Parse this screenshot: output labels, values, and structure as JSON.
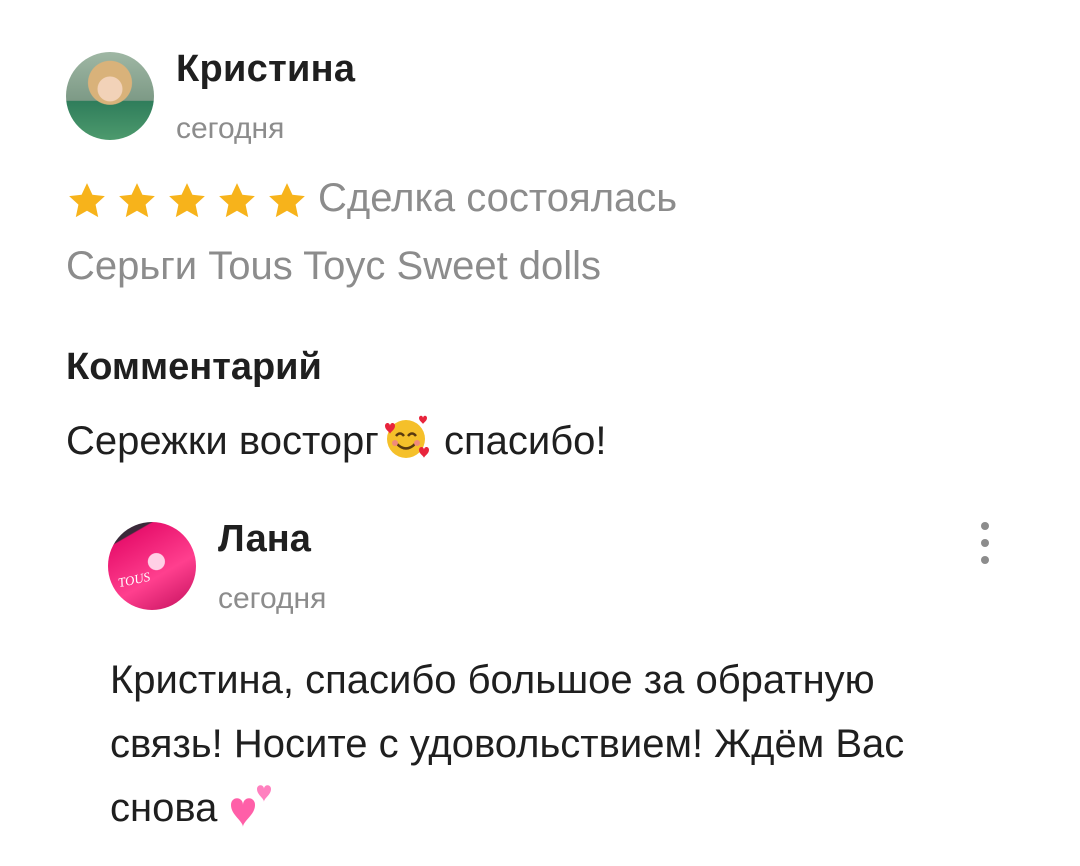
{
  "review": {
    "author": "Кристина",
    "date": "сегодня",
    "rating": 5,
    "rating_max": 5,
    "star_color": "#f7b31b",
    "deal_status": "Сделка состоялась",
    "product": "Серьги Tous Toyc Sweet dolls",
    "comment_heading": "Комментарий",
    "comment_before": "Сережки восторг",
    "comment_emoji": "smiling-face-with-hearts",
    "comment_after": " спасибо!"
  },
  "reply": {
    "author": "Лана",
    "date": "сегодня",
    "avatar_logo_text": "TOUS",
    "text": "Кристина, спасибо большое за обратную связь! Носите с удовольствием! Ждём Вас снова",
    "emoji": "two-hearts"
  }
}
